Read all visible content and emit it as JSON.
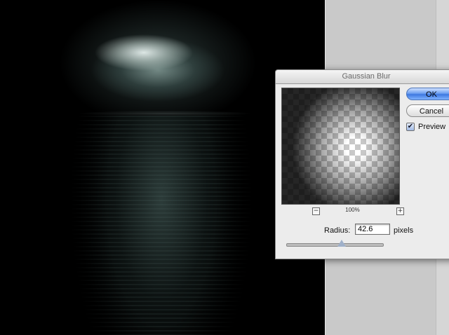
{
  "dialog": {
    "title": "Gaussian Blur",
    "ok_label": "OK",
    "cancel_label": "Cancel",
    "preview_label": "Preview",
    "preview_checked": true,
    "checkmark_glyph": "✔",
    "zoom_level": "100%",
    "zoom_out_glyph": "−",
    "zoom_in_glyph": "+",
    "radius_label": "Radius:",
    "radius_value": "42.6",
    "radius_units": "pixels",
    "radius_slider_fraction": 0.58
  },
  "colors": {
    "ok_button": "#3e78e0",
    "dialog_bg": "#ececec",
    "workspace_bg": "#c9c9c9",
    "canvas_bg": "#000000"
  }
}
